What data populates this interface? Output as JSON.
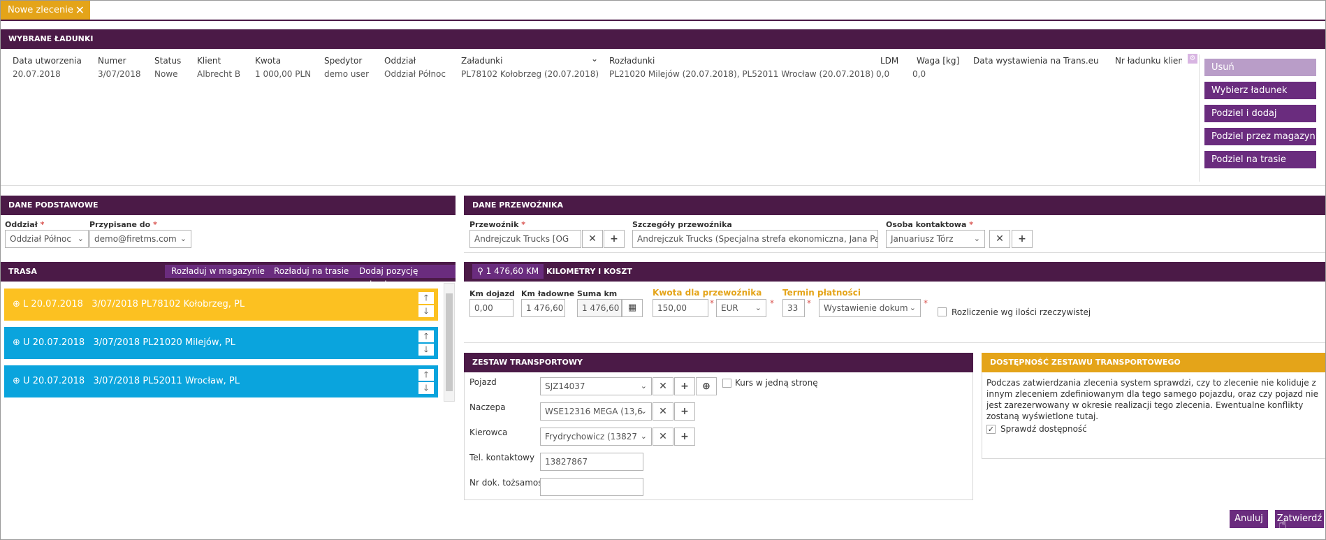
{
  "tab": {
    "title": "Nowe zlecenie",
    "close": "✕"
  },
  "loads": {
    "header": "WYBRANE ŁADUNKI",
    "columns": [
      "Data utworzenia",
      "Numer",
      "Status",
      "Klient",
      "Kwota",
      "Spedytor",
      "Oddział",
      "Załadunki",
      "Rozładunki",
      "LDM",
      "Waga [kg]",
      "Data wystawienia na Trans.eu",
      "Nr ładunku klienta"
    ],
    "row": [
      "20.07.2018",
      "3/07/2018",
      "Nowe",
      "Albrecht B",
      "1 000,00 PLN",
      "demo user",
      "Oddział Północ",
      "PL78102 Kołobrzeg (20.07.2018)",
      "PL21020 Milejów (20.07.2018), PL52011 Wrocław (20.07.2018)",
      "0,0",
      "0,0",
      "",
      ""
    ],
    "actions": [
      "Usuń",
      "Wybierz ładunek",
      "Podziel i dodaj",
      "Podziel przez magazyn",
      "Podziel na trasie"
    ]
  },
  "basic": {
    "header": "DANE PODSTAWOWE",
    "branch_label": "Oddział",
    "branch_value": "Oddział Północ",
    "assigned_label": "Przypisane do",
    "assigned_value": "demo@firetms.com"
  },
  "carrier": {
    "header": "DANE PRZEWOŹNIKA",
    "carrier_label": "Przewoźnik",
    "carrier_value": "Andrejczuk Trucks [OG",
    "details_label": "Szczegóły przewoźnika",
    "details_value": "Andrejczuk Trucks (Specjalna strefa ekonomiczna, Jana Pawła",
    "contact_label": "Osoba kontaktowa",
    "contact_value": "Januariusz Tórz"
  },
  "route": {
    "header": "TRASA",
    "buttons": [
      "Rozładuj w magazynie",
      "Rozładuj na trasie",
      "Dodaj pozycję pojazdu"
    ],
    "items": [
      {
        "text": "L 20.07.2018   3/07/2018 PL78102 Kołobrzeg, PL"
      },
      {
        "text": "U 20.07.2018   3/07/2018 PL21020 Milejów, PL"
      },
      {
        "text": "U 20.07.2018   3/07/2018 PL52011 Wrocław, PL"
      }
    ]
  },
  "km": {
    "badge": "1 476,60 KM",
    "header": "KILOMETRY I KOSZT",
    "approach_label": "Km dojazd",
    "approach_value": "0,00",
    "loaded_label": "Km ładowne",
    "loaded_value": "1 476,60",
    "sum_label": "Suma km",
    "sum_value": "1 476,60",
    "amount_label": "Kwota dla przewoźnika",
    "amount_value": "150,00",
    "currency": "EUR",
    "term_label": "Termin płatności",
    "term_value": "33",
    "term_type": "Wystawienie dokum",
    "settle_label": "Rozliczenie wg ilości rzeczywistej"
  },
  "set": {
    "header": "ZESTAW TRANSPORTOWY",
    "vehicle_label": "Pojazd",
    "vehicle_value": "SJZ14037",
    "oneway_label": "Kurs w jedną stronę",
    "trailer_label": "Naczepa",
    "trailer_value": "WSE12316 MEGA (13,6",
    "driver_label": "Kierowca",
    "driver_value": "Frydrychowicz (13827",
    "phone_label": "Tel. kontaktowy",
    "phone_value": "13827867",
    "id_label": "Nr dok. tożsamości",
    "id_value": ""
  },
  "availability": {
    "header": "DOSTĘPNOŚĆ ZESTAWU TRANSPORTOWEGO",
    "text": "Podczas zatwierdzania zlecenia system sprawdzi, czy to zlecenie nie koliduje z innym zleceniem zdefiniowanym dla tego samego pojazdu, oraz czy pojazd nie jest zarezerwowany w okresie realizacji tego zlecenia. Ewentualne konflikty zostaną wyświetlone tutaj.",
    "check_label": "Sprawdź dostępność"
  },
  "footer": {
    "cancel": "Anuluj",
    "confirm": "Zatwierdź"
  }
}
